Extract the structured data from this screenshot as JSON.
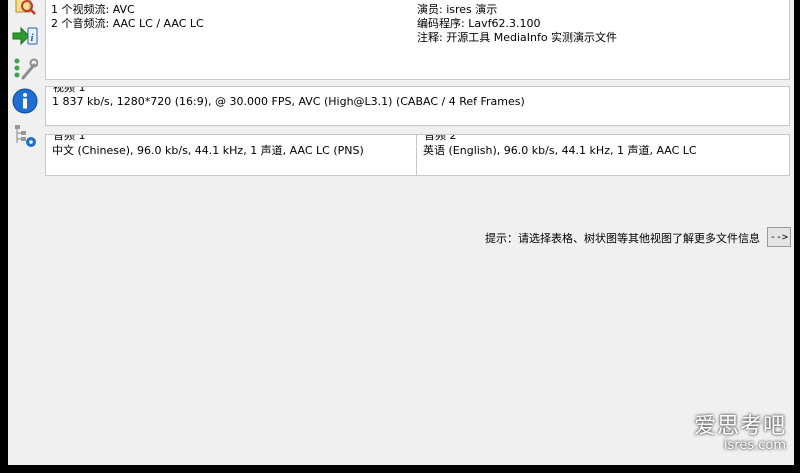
{
  "general": {
    "video_count": "1 个视频流: AVC",
    "audio_count": "2 个音频流: AAC LC / AAC LC",
    "performer": "演员: isres 演示",
    "encoder": "编码程序: Lavf62.3.100",
    "comment": "注释: 开源工具 MediaInfo 实测演示文件"
  },
  "video": {
    "title": "视频 1",
    "details": "1 837 kb/s, 1280*720 (16:9), @ 30.000 FPS, AVC (High@L3.1) (CABAC / 4 Ref Frames)"
  },
  "audio": [
    {
      "title": "音频 1",
      "details": "中文 (Chinese), 96.0 kb/s, 44.1 kHz, 1 声道, AAC LC (PNS)"
    },
    {
      "title": "音频 2",
      "details": "英语 (English), 96.0 kb/s, 44.1 kHz, 1 声道, AAC LC"
    }
  ],
  "hint": {
    "text": "提示：请选择表格、树状图等其他视图了解更多文件信息",
    "button": "-->"
  },
  "watermark": {
    "line1": "爱思考吧",
    "line2": "isres.com"
  }
}
